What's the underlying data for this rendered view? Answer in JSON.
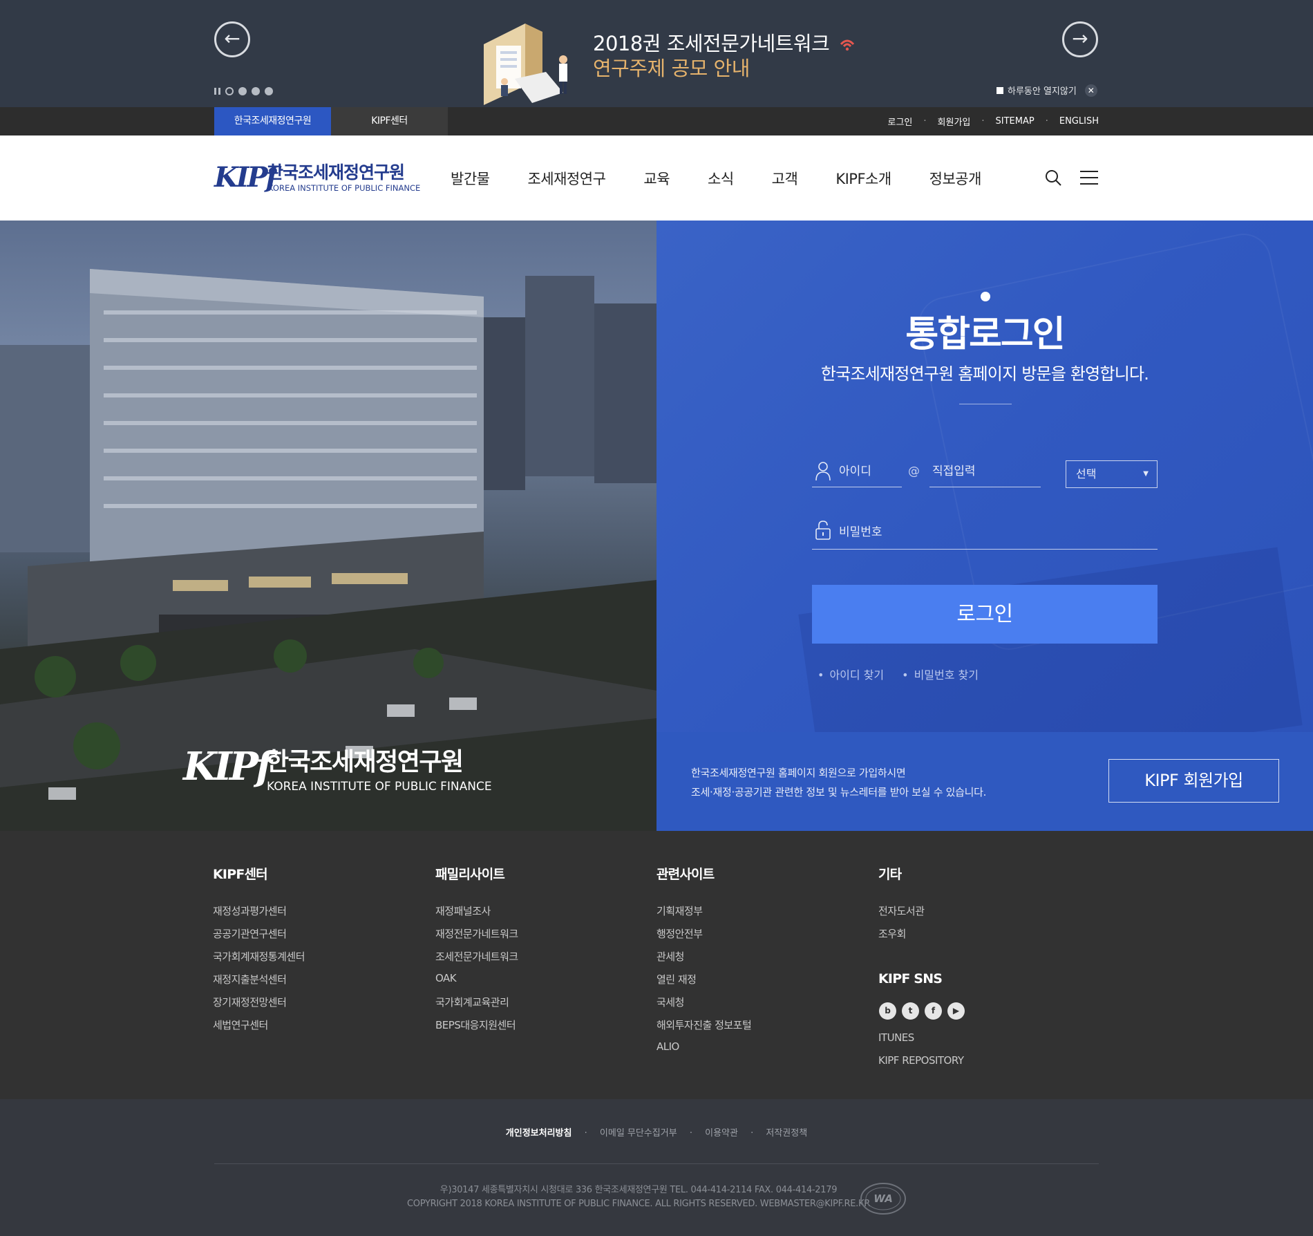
{
  "promo": {
    "headline": "2018권 조세전문가네트워크",
    "subhead": "연구주제 공모 안내",
    "prev_icon": "arrow-left-icon",
    "next_icon": "arrow-right-icon",
    "today_close_label": "하루동안 열지않기",
    "close_symbol": "✕",
    "slide_count": 4,
    "active_slide": 1
  },
  "utility": {
    "site_tabs": [
      "한국조세재정연구원",
      "KIPF센터"
    ],
    "links": [
      "로그인",
      "회원가입",
      "SITEMAP",
      "ENGLISH"
    ],
    "separator": "·"
  },
  "header": {
    "logo_mark": "KIPf",
    "logo_korean": "한국조세재정연구원",
    "logo_english": "KOREA INSTITUTE OF PUBLIC FINANCE",
    "nav": [
      "발간물",
      "조세재정연구",
      "교육",
      "소식",
      "고객",
      "KIPF소개",
      "정보공개"
    ],
    "search_icon": "search-icon",
    "menu_icon": "hamburger-menu-icon"
  },
  "login": {
    "title": "통합로그인",
    "welcome": "한국조세재정연구원 홈페이지 방문을 환영합니다.",
    "id_placeholder": "아이디",
    "at_sign": "@",
    "domain_placeholder": "직접입력",
    "domain_select": "선택",
    "password_placeholder": "비밀번호",
    "login_button": "로그인",
    "find_id": "아이디 찾기",
    "find_password": "비밀번호 찾기",
    "join_text_1": "한국조세재정연구원 홈페이지 회원으로 가입하시면",
    "join_text_2": "조세·재정·공공기관 관련한 정보 및 뉴스레터를 받아 보실 수 있습니다.",
    "join_button": "KIPF 회원가입",
    "accent_color": "#4a7ef0",
    "panel_color": "#3159c1"
  },
  "footer": {
    "columns": [
      {
        "title": "KIPF센터",
        "items": [
          "재정성과평가센터",
          "공공기관연구센터",
          "국가회계재정통계센터",
          "재정지출분석센터",
          "장기재정전망센터",
          "세법연구센터"
        ]
      },
      {
        "title": "패밀리사이트",
        "items": [
          "재정패널조사",
          "재정전문가네트워크",
          "조세전문가네트워크",
          "OAK",
          "국가회계교육관리",
          "BEPS대응지원센터"
        ]
      },
      {
        "title": "관련사이트",
        "items": [
          "기획재정부",
          "행정안전부",
          "관세청",
          "열린 재정",
          "국세청",
          "해외투자진출 정보포털",
          "ALIO"
        ]
      },
      {
        "title": "기타",
        "items": [
          "전자도서관",
          "조우회"
        ]
      }
    ],
    "sns_title": "KIPF SNS",
    "sns": [
      {
        "icon": "blog-icon",
        "glyph": "b"
      },
      {
        "icon": "twitter-icon",
        "glyph": "t"
      },
      {
        "icon": "facebook-icon",
        "glyph": "f"
      },
      {
        "icon": "youtube-icon",
        "glyph": "▶"
      }
    ],
    "extra_links": [
      "ITUNES",
      "KIPF REPOSITORY"
    ],
    "policy_links": [
      "개인정보처리방침",
      "이메일 무단수집거부",
      "이용약관",
      "저작권정책"
    ],
    "address": "우)30147 세종특별자치시 시청대로 336 한국조세재정연구원 TEL. 044-414-2114 FAX. 044-414-2179",
    "copyright": "COPYRIGHT 2018 KOREA INSTITUTE OF PUBLIC FINANCE. ALL RIGHTS RESERVED. WEBMASTER@KIPF.RE.KR",
    "wa_mark": "WA"
  }
}
